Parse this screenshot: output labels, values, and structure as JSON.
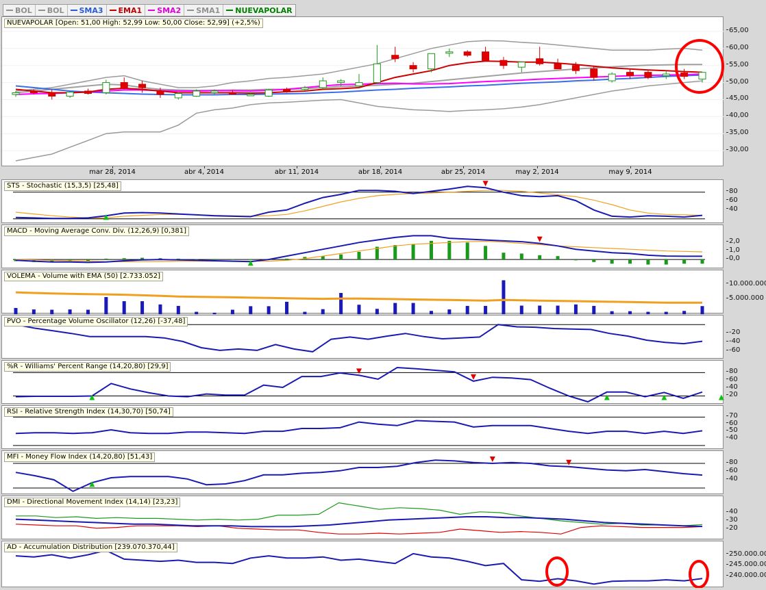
{
  "legend": [
    {
      "label": "BOL",
      "color": "#909090"
    },
    {
      "label": "BOL",
      "color": "#909090"
    },
    {
      "label": "SMA3",
      "color": "#2a5bd7"
    },
    {
      "label": "EMA1",
      "color": "#c00000"
    },
    {
      "label": "SMA2",
      "color": "#e000e0"
    },
    {
      "label": "SMA1",
      "color": "#909090"
    },
    {
      "label": "NUEVAPOLAR",
      "color": "#008000"
    }
  ],
  "dates": [
    "mar 28, 2014",
    "abr 4, 2014",
    "abr 11, 2014",
    "abr 18, 2014",
    "abr 25, 2014",
    "may 2, 2014",
    "may 9, 2014"
  ],
  "panels": {
    "price": {
      "title": "NUEVAPOLAR [Open: 51,00  High: 52,99  Low: 50,00  Close: 52,99] (+2,5%)"
    },
    "sts": {
      "title": "STS - Stochastic (15,3,5) [25,48]"
    },
    "macd": {
      "title": "MACD - Moving Average Conv. Div. (12,26,9) [0,381]"
    },
    "volema": {
      "title": "VOLEMA - Volume with EMA (50) [2.733.052]"
    },
    "pvo": {
      "title": "PVO - Percentage Volume Oscillator (12,26) [-37,48]"
    },
    "wr": {
      "title": "%R - Williams' Percent Range (14,20,80) [29,9]"
    },
    "rsi": {
      "title": "RSI - Relative Strength Index (14,30,70) [50,74]"
    },
    "mfi": {
      "title": "MFI - Money Flow Index (14,20,80) [51,43]"
    },
    "dmi": {
      "title": "DMI - Directional Movement Index (14,14) [23,23]"
    },
    "ad": {
      "title": "AD - Accumulation Distribution [239.070.370,44]"
    }
  },
  "chart_data": [
    {
      "id": "price",
      "type": "candlestick",
      "ylim": [
        26,
        68
      ],
      "yticks": [
        "65,00",
        "60,00",
        "55,00",
        "50,00",
        "45,00",
        "40,00",
        "35,00",
        "30,00"
      ],
      "ytick_values": [
        65,
        60,
        55,
        50,
        45,
        40,
        35,
        30
      ],
      "ohlc": [
        [
          46.5,
          47.5,
          45.8,
          47
        ],
        [
          47.5,
          48,
          46.5,
          47
        ],
        [
          47,
          48,
          45,
          46
        ],
        [
          46,
          47.5,
          45.5,
          47.2
        ],
        [
          47.5,
          48.2,
          46.5,
          46.8
        ],
        [
          47,
          50.8,
          46.5,
          50
        ],
        [
          50,
          51.5,
          48,
          48.2
        ],
        [
          49.5,
          50.5,
          47,
          48.5
        ],
        [
          47.5,
          48.5,
          45.5,
          46.5
        ],
        [
          45.5,
          47.2,
          45,
          46.8
        ],
        [
          46,
          48,
          45.8,
          47.5
        ],
        [
          47,
          48,
          46.5,
          47.5
        ],
        [
          47,
          47.8,
          46.5,
          46.8
        ],
        [
          46.5,
          47.2,
          46,
          46.5
        ],
        [
          46,
          48,
          45.8,
          47.8
        ],
        [
          48,
          48.5,
          47,
          47.5
        ],
        [
          48,
          49,
          47.5,
          48.5
        ],
        [
          48.5,
          51.5,
          48,
          50.5
        ],
        [
          50,
          51,
          49,
          50.5
        ],
        [
          49,
          52.5,
          48.5,
          50
        ],
        [
          50,
          61,
          49.5,
          55.5
        ],
        [
          58,
          60.5,
          56,
          57
        ],
        [
          55,
          56,
          53,
          54
        ],
        [
          54,
          58.5,
          53,
          58.5
        ],
        [
          59,
          60,
          57.5,
          59
        ],
        [
          59,
          59.5,
          57.5,
          58
        ],
        [
          59,
          60.5,
          56.5,
          56.5
        ],
        [
          56.5,
          57.5,
          54,
          55
        ],
        [
          54.5,
          56,
          53,
          56
        ],
        [
          57,
          60.5,
          55,
          55.5
        ],
        [
          55.5,
          57,
          54,
          54
        ],
        [
          55,
          56,
          52.5,
          53.5
        ],
        [
          54,
          55,
          50.5,
          51.5
        ],
        [
          50.5,
          53,
          50,
          52.5
        ],
        [
          53,
          54,
          51,
          52
        ],
        [
          53,
          53.5,
          51,
          51.5
        ],
        [
          52,
          53.5,
          51,
          52.5
        ],
        [
          52.8,
          54,
          51,
          51.8
        ],
        [
          51,
          53,
          50,
          52.99
        ]
      ],
      "bol_upper": [
        47.5,
        48,
        48.5,
        49.5,
        50.5,
        51.5,
        52,
        50.5,
        49.5,
        48.5,
        48.5,
        49,
        50,
        50.5,
        51.2,
        51.5,
        52,
        52.5,
        53.5,
        54.5,
        55.5,
        57,
        58.5,
        60,
        61,
        62,
        62.3,
        62.2,
        61.8,
        61.5,
        61,
        60.5,
        60,
        59.5,
        59.5,
        59.5,
        59.8,
        60,
        59.5
      ],
      "bol_mid": [
        46.5,
        47,
        47,
        47.5,
        48,
        48.5,
        48.2,
        47.5,
        47.2,
        47.2,
        47.3,
        47.3,
        47.3,
        47.4,
        47.7,
        47.8,
        48,
        48.5,
        49,
        49.5,
        50.5,
        51.5,
        52.2,
        53,
        53.5,
        54,
        54.5,
        55,
        55.2,
        55,
        54.8,
        54.5,
        54,
        53.8,
        53.8,
        53.6,
        53.4,
        53.2,
        53
      ],
      "bol_lower": [
        27,
        28,
        29,
        31,
        33,
        35,
        35.5,
        35.5,
        35.5,
        37.5,
        41,
        42,
        42.5,
        43.5,
        44,
        44.2,
        44.5,
        44.8,
        45,
        44,
        43,
        42.5,
        42,
        41.8,
        41.5,
        41.8,
        42,
        42.3,
        42.8,
        43.5,
        44.5,
        45.5,
        46.5,
        47.5,
        48.2,
        49,
        49.5,
        50,
        50.5
      ],
      "sma3": [
        49,
        48.5,
        48,
        47.5,
        47.2,
        47,
        46.8,
        46.6,
        46.5,
        46.4,
        46.4,
        46.4,
        46.5,
        46.5,
        46.6,
        46.7,
        46.8,
        47,
        47.2,
        47.5,
        47.8,
        48,
        48.3,
        48.5,
        48.7,
        49,
        49.2,
        49.5,
        49.8,
        50,
        50.2,
        50.5,
        50.7,
        51,
        51.2,
        51.5,
        51.8,
        52,
        52.2
      ],
      "ema1": [
        48,
        47.5,
        47,
        47,
        47.2,
        48,
        48.3,
        48,
        47.5,
        47,
        47,
        47,
        47,
        46.9,
        47,
        47.3,
        47.5,
        48,
        48.2,
        48.5,
        50,
        51.5,
        52.5,
        53.5,
        55,
        55.8,
        56.3,
        56.2,
        56,
        56,
        55.7,
        55.3,
        54.8,
        54.3,
        54,
        53.7,
        53.5,
        53.2,
        53
      ],
      "sma2": [
        46.5,
        46.7,
        46.8,
        47,
        47.2,
        47.5,
        47.8,
        47.8,
        47.6,
        47.5,
        47.5,
        47.6,
        47.6,
        47.5,
        47.7,
        48,
        48.5,
        49,
        49.4,
        49.5,
        49.7,
        49.8,
        49.6,
        49.6,
        49.7,
        50,
        50.3,
        50.5,
        50.7,
        51,
        51.2,
        51.4,
        51.6,
        51.8,
        52,
        52.1,
        52.2,
        52.3,
        52.5
      ],
      "sma1": [
        47,
        47.5,
        48,
        48.5,
        49,
        49.5,
        49.3,
        48.5,
        48,
        47.8,
        47.7,
        47.7,
        47.8,
        47.8,
        48,
        48,
        48.2,
        48.5,
        48.8,
        49,
        49.2,
        49.5,
        49.8,
        50.3,
        50.8,
        51.3,
        51.8,
        52.3,
        52.8,
        53.2,
        53.6,
        54,
        54.3,
        54.6,
        54.9,
        55.1,
        55.2,
        55.3,
        55.3
      ]
    },
    {
      "id": "sts",
      "type": "line",
      "ylim": [
        15,
        95
      ],
      "yticks": [
        "80",
        "60",
        "40"
      ],
      "ytick_values": [
        80,
        60,
        40
      ],
      "hlines": [
        80,
        20
      ],
      "k": [
        23,
        22,
        21,
        21,
        22,
        27,
        33,
        34,
        33,
        31,
        29,
        27,
        26,
        25,
        35,
        40,
        55,
        68,
        75,
        84,
        84,
        82,
        77,
        82,
        87,
        93,
        90,
        80,
        72,
        70,
        72,
        61,
        40,
        26,
        24,
        27,
        26,
        24,
        28
      ],
      "d": [
        35,
        31,
        27,
        24,
        22,
        22,
        26,
        28,
        30,
        30,
        29,
        28,
        27,
        26,
        27,
        30,
        38,
        48,
        58,
        66,
        72,
        75,
        77,
        78,
        80,
        82,
        84,
        84,
        82,
        78,
        74,
        70,
        62,
        52,
        40,
        33,
        30,
        29,
        28
      ],
      "sell_signals": [
        26
      ],
      "buy_signals": [
        5
      ]
    },
    {
      "id": "macd",
      "type": "bar+line",
      "ylim": [
        -0.8,
        3.4
      ],
      "yticks": [
        "2,0",
        "1,0",
        "0,0"
      ],
      "ytick_values": [
        2,
        1,
        0
      ],
      "hlines": [
        0
      ],
      "histogram": [
        -0.2,
        -0.3,
        -0.3,
        -0.2,
        -0.2,
        0.1,
        0.15,
        0.2,
        0.15,
        0.1,
        0.05,
        0.0,
        0.02,
        0.02,
        0.05,
        0.1,
        0.3,
        0.4,
        0.6,
        0.9,
        1.5,
        1.7,
        1.8,
        2.2,
        2.2,
        2.0,
        1.6,
        0.8,
        0.7,
        0.5,
        0.4,
        -0.1,
        -0.3,
        -0.5,
        -0.5,
        -0.6,
        -0.6,
        -0.5,
        -0.5
      ],
      "macd": [
        -0.1,
        -0.2,
        -0.3,
        -0.3,
        -0.35,
        -0.3,
        -0.15,
        -0.05,
        0.0,
        -0.05,
        -0.1,
        -0.15,
        -0.2,
        -0.25,
        0.0,
        0.4,
        0.8,
        1.2,
        1.6,
        2.0,
        2.3,
        2.6,
        2.8,
        2.8,
        2.5,
        2.4,
        2.3,
        2.2,
        2.1,
        1.9,
        1.6,
        1.2,
        1.0,
        0.8,
        0.7,
        0.5,
        0.4,
        0.38,
        0.381
      ],
      "signal": [
        0.0,
        -0.05,
        -0.1,
        -0.15,
        -0.2,
        -0.25,
        -0.27,
        -0.26,
        -0.24,
        -0.22,
        -0.2,
        -0.2,
        -0.2,
        -0.21,
        -0.2,
        -0.1,
        0.1,
        0.4,
        0.7,
        1.0,
        1.3,
        1.6,
        1.8,
        1.9,
        2.0,
        2.1,
        2.15,
        2.05,
        1.9,
        1.75,
        1.6,
        1.5,
        1.4,
        1.3,
        1.2,
        1.1,
        1.0,
        0.95,
        0.9
      ],
      "sell_signals": [
        29
      ],
      "buy_signals": [
        13
      ]
    },
    {
      "id": "volema",
      "type": "bar+line",
      "ylim": [
        0,
        13000000
      ],
      "yticks": [
        "10.000.000",
        "5.000.000"
      ],
      "ytick_values": [
        10000000,
        5000000
      ],
      "volume": [
        2100000,
        1600000,
        1500000,
        1600000,
        1500000,
        5800000,
        4400000,
        4400000,
        3300000,
        2800000,
        800000,
        500000,
        1500000,
        2700000,
        2700000,
        4200000,
        800000,
        1700000,
        7200000,
        3200000,
        1800000,
        3800000,
        3800000,
        1100000,
        1600000,
        2800000,
        2800000,
        11500000,
        2900000,
        2900000,
        2900000,
        3300000,
        2800000,
        1000000,
        1000000,
        800000,
        800000,
        1100000,
        2733052
      ],
      "ema": [
        7400000,
        7200000,
        7000000,
        6900000,
        6800000,
        6700000,
        6600000,
        6400000,
        6200000,
        6000000,
        5900000,
        5800000,
        5700000,
        5600000,
        5500000,
        5400000,
        5300000,
        5200000,
        5300000,
        5300000,
        5200000,
        5100000,
        5000000,
        4900000,
        4800000,
        4700000,
        4600000,
        4800000,
        4700000,
        4600000,
        4500000,
        4400000,
        4300000,
        4200000,
        4100000,
        4000000,
        3900000,
        3900000,
        3900000
      ]
    },
    {
      "id": "pvo",
      "type": "line",
      "ylim": [
        -72,
        8
      ],
      "yticks": [
        "-20",
        "-40",
        "-60"
      ],
      "ytick_values": [
        -20,
        -40,
        -60
      ],
      "hlines": [
        0
      ],
      "values": [
        0,
        -8,
        -14,
        -20,
        -27,
        -27,
        -27,
        -27,
        -30,
        -38,
        -52,
        -58,
        -55,
        -58,
        -45,
        -55,
        -61,
        -33,
        -28,
        -33,
        -26,
        -20,
        -27,
        -32,
        -30,
        -28,
        0,
        -5,
        -6,
        -9,
        -10,
        -11,
        -20,
        -26,
        -35,
        -40,
        -43,
        -37.48
      ]
    },
    {
      "id": "wr",
      "type": "line",
      "ylim": [
        5,
        100
      ],
      "yticks": [
        "80",
        "60",
        "40",
        "20"
      ],
      "ytick_values": [
        80,
        60,
        40,
        20
      ],
      "hlines": [
        80,
        20
      ],
      "values": [
        18,
        19,
        19,
        19,
        20,
        52,
        38,
        28,
        20,
        18,
        25,
        22,
        22,
        48,
        42,
        70,
        70,
        79,
        73,
        63,
        93,
        90,
        86,
        82,
        58,
        68,
        66,
        62,
        40,
        20,
        5,
        30,
        30,
        18,
        29,
        14,
        29.9
      ],
      "sell_signals": [
        18,
        24
      ],
      "buy_signals": [
        4,
        31,
        34,
        37
      ]
    },
    {
      "id": "rsi",
      "type": "line",
      "ylim": [
        28,
        78
      ],
      "yticks": [
        "70",
        "60",
        "50",
        "40"
      ],
      "ytick_values": [
        70,
        60,
        50,
        40
      ],
      "hlines": [
        70,
        30
      ],
      "values": [
        47,
        48,
        48,
        47,
        48,
        52,
        48,
        47,
        47,
        49,
        49,
        48,
        47,
        50,
        50,
        54,
        54,
        55,
        63,
        60,
        58,
        65,
        64,
        63,
        56,
        58,
        58,
        58,
        54,
        50,
        47,
        50,
        50,
        47,
        50,
        47,
        50.74
      ]
    },
    {
      "id": "mfi",
      "type": "line",
      "ylim": [
        10,
        100
      ],
      "yticks": [
        "80",
        "60",
        "40"
      ],
      "ytick_values": [
        80,
        60,
        40
      ],
      "hlines": [
        80,
        20
      ],
      "values": [
        58,
        50,
        40,
        12,
        33,
        45,
        48,
        48,
        48,
        42,
        28,
        30,
        38,
        52,
        52,
        56,
        58,
        62,
        70,
        70,
        73,
        82,
        88,
        86,
        82,
        80,
        82,
        80,
        74,
        72,
        68,
        64,
        62,
        65,
        60,
        55,
        51.43
      ],
      "sell_signals": [
        25,
        29
      ],
      "buy_signals": [
        4
      ]
    },
    {
      "id": "dmi",
      "type": "line",
      "ylim": [
        10,
        55
      ],
      "yticks": [
        "40",
        "30",
        "20"
      ],
      "ytick_values": [
        40,
        30,
        20
      ],
      "adx": [
        32,
        31,
        30,
        29,
        28,
        27,
        26,
        26,
        25,
        24,
        24,
        24,
        23,
        23,
        23,
        24,
        25,
        27,
        29,
        31,
        32,
        33,
        34,
        35,
        35,
        34,
        34,
        33,
        32,
        30,
        28,
        27,
        26,
        25,
        24,
        23.23
      ],
      "plus_di": [
        36,
        36,
        34,
        35,
        33,
        34,
        33,
        33,
        32,
        31,
        32,
        31,
        32,
        37,
        37,
        38,
        52,
        48,
        44,
        46,
        45,
        43,
        38,
        41,
        40,
        36,
        33,
        30,
        28,
        26,
        27,
        25,
        25,
        24,
        25.5
      ],
      "minus_di": [
        26,
        25,
        24,
        24,
        21,
        22,
        24,
        24,
        24,
        23,
        24,
        21,
        20,
        19,
        19,
        16,
        14,
        14,
        15,
        14,
        15,
        16,
        20,
        18,
        16,
        17,
        16,
        14,
        22,
        24,
        23,
        22,
        22,
        22,
        23
      ]
    },
    {
      "id": "ad",
      "type": "line",
      "ylim": [
        236000000,
        253000000
      ],
      "yticks": [
        "250.000.000",
        "245.000.000",
        "240.000.000"
      ],
      "ytick_values": [
        250000000,
        245000000,
        240000000
      ],
      "values": [
        249500000,
        249000000,
        250000000,
        248500000,
        250000000,
        252000000,
        248000000,
        247500000,
        247000000,
        247500000,
        246500000,
        246500000,
        246000000,
        248500000,
        249500000,
        248500000,
        248500000,
        249000000,
        247500000,
        248000000,
        247000000,
        246000000,
        250500000,
        249000000,
        248500000,
        247000000,
        245000000,
        246000000,
        238500000,
        237800000,
        239000000,
        238000000,
        236500000,
        237800000,
        238000000,
        238000000,
        238500000,
        238000000,
        239070370
      ]
    }
  ]
}
